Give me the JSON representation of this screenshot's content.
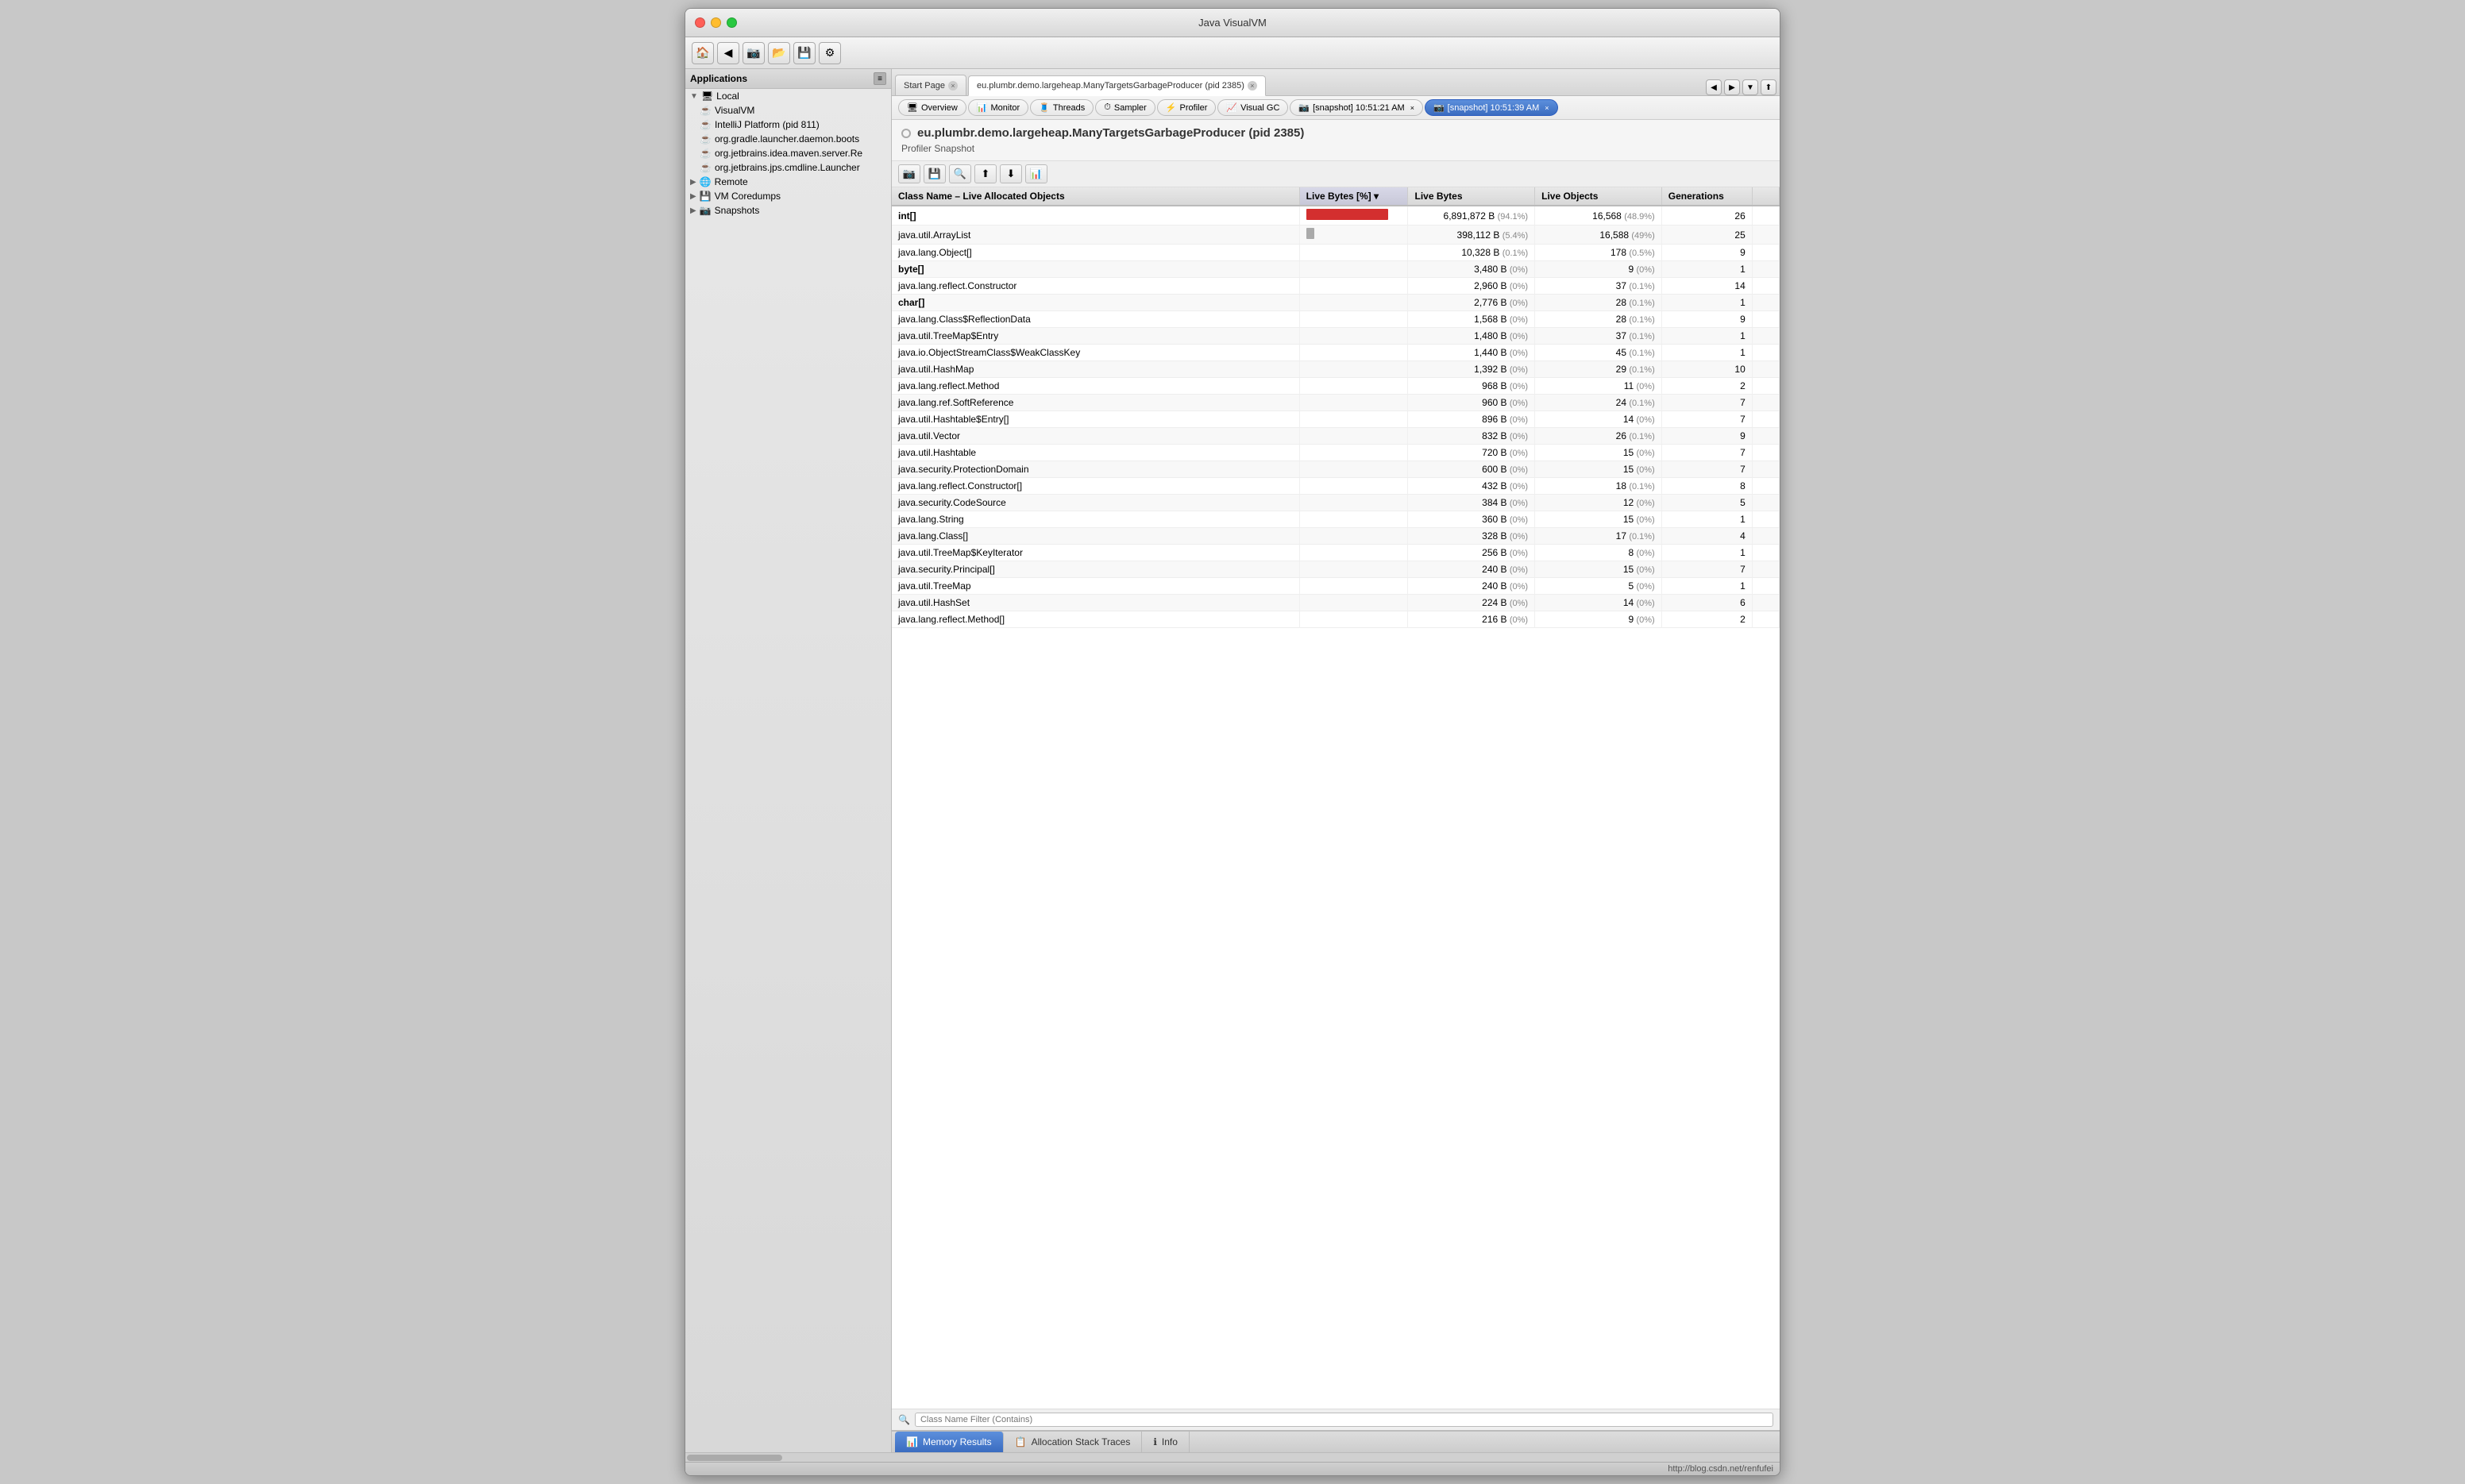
{
  "window": {
    "title": "Java VisualVM"
  },
  "toolbar": {
    "buttons": [
      "🏠",
      "⬅",
      "📷",
      "📁",
      "💾",
      "🔧"
    ]
  },
  "tabs": [
    {
      "label": "Start Page",
      "active": false,
      "closable": true
    },
    {
      "label": "eu.plumbr.demo.largeheap.ManyTargetsGarbageProducer (pid 2385)",
      "active": true,
      "closable": true
    }
  ],
  "nav_tabs": [
    {
      "label": "Overview",
      "icon": "🖥"
    },
    {
      "label": "Monitor",
      "icon": "📊"
    },
    {
      "label": "Threads",
      "icon": "🧵"
    },
    {
      "label": "Sampler",
      "icon": "⏱"
    },
    {
      "label": "Profiler",
      "icon": "⚡"
    },
    {
      "label": "Visual GC",
      "icon": "📈"
    },
    {
      "label": "[snapshot] 10:51:21 AM",
      "icon": "📷",
      "closable": true
    },
    {
      "label": "[snapshot] 10:51:39 AM",
      "icon": "📷",
      "active": true,
      "closable": true
    }
  ],
  "app": {
    "title": "eu.plumbr.demo.largeheap.ManyTargetsGarbageProducer (pid 2385)",
    "section": "Profiler Snapshot"
  },
  "sidebar": {
    "title": "Applications",
    "items": [
      {
        "label": "Local",
        "type": "group",
        "expanded": true,
        "indent": 0
      },
      {
        "label": "VisualVM",
        "type": "app",
        "indent": 1
      },
      {
        "label": "IntelliJ Platform (pid 811)",
        "type": "app",
        "indent": 1
      },
      {
        "label": "org.gradle.launcher.daemon.boots",
        "type": "app",
        "indent": 1
      },
      {
        "label": "org.jetbrains.idea.maven.server.Re",
        "type": "app",
        "indent": 1
      },
      {
        "label": "org.jetbrains.jps.cmdline.Launcher",
        "type": "app",
        "indent": 1
      },
      {
        "label": "Remote",
        "type": "group",
        "indent": 0
      },
      {
        "label": "VM Coredumps",
        "type": "group",
        "indent": 0
      },
      {
        "label": "Snapshots",
        "type": "group",
        "indent": 0
      }
    ]
  },
  "profiler_toolbar": {
    "buttons": [
      "📸",
      "💾",
      "🔍",
      "⬆",
      "⬇",
      "📊"
    ]
  },
  "table": {
    "columns": [
      {
        "label": "Class Name – Live Allocated Objects",
        "key": "class_name"
      },
      {
        "label": "Live Bytes [%]",
        "key": "bar",
        "sorted": true
      },
      {
        "label": "Live Bytes",
        "key": "live_bytes"
      },
      {
        "label": "Live Objects",
        "key": "live_objects"
      },
      {
        "label": "Generations",
        "key": "generations"
      }
    ],
    "rows": [
      {
        "class_name": "int[]",
        "bar": 94,
        "live_bytes": "6,891,872 B",
        "live_bytes_pct": "(94.1%)",
        "live_objects": "16,568",
        "live_objects_pct": "(48.9%)",
        "generations": "26",
        "bold": true
      },
      {
        "class_name": "java.util.ArrayList",
        "bar": 5,
        "live_bytes": "398,112 B",
        "live_bytes_pct": "(5.4%)",
        "live_objects": "16,588",
        "live_objects_pct": "(49%)",
        "generations": "25",
        "bold": false
      },
      {
        "class_name": "java.lang.Object[]",
        "bar": 0,
        "live_bytes": "10,328 B",
        "live_bytes_pct": "(0.1%)",
        "live_objects": "178",
        "live_objects_pct": "(0.5%)",
        "generations": "9",
        "bold": false
      },
      {
        "class_name": "byte[]",
        "bar": 0,
        "live_bytes": "3,480 B",
        "live_bytes_pct": "(0%)",
        "live_objects": "9",
        "live_objects_pct": "(0%)",
        "generations": "1",
        "bold": true
      },
      {
        "class_name": "java.lang.reflect.Constructor",
        "bar": 0,
        "live_bytes": "2,960 B",
        "live_bytes_pct": "(0%)",
        "live_objects": "37",
        "live_objects_pct": "(0.1%)",
        "generations": "14",
        "bold": false
      },
      {
        "class_name": "char[]",
        "bar": 0,
        "live_bytes": "2,776 B",
        "live_bytes_pct": "(0%)",
        "live_objects": "28",
        "live_objects_pct": "(0.1%)",
        "generations": "1",
        "bold": true
      },
      {
        "class_name": "java.lang.Class$ReflectionData",
        "bar": 0,
        "live_bytes": "1,568 B",
        "live_bytes_pct": "(0%)",
        "live_objects": "28",
        "live_objects_pct": "(0.1%)",
        "generations": "9",
        "bold": false
      },
      {
        "class_name": "java.util.TreeMap$Entry",
        "bar": 0,
        "live_bytes": "1,480 B",
        "live_bytes_pct": "(0%)",
        "live_objects": "37",
        "live_objects_pct": "(0.1%)",
        "generations": "1",
        "bold": false
      },
      {
        "class_name": "java.io.ObjectStreamClass$WeakClassKey",
        "bar": 0,
        "live_bytes": "1,440 B",
        "live_bytes_pct": "(0%)",
        "live_objects": "45",
        "live_objects_pct": "(0.1%)",
        "generations": "1",
        "bold": false
      },
      {
        "class_name": "java.util.HashMap",
        "bar": 0,
        "live_bytes": "1,392 B",
        "live_bytes_pct": "(0%)",
        "live_objects": "29",
        "live_objects_pct": "(0.1%)",
        "generations": "10",
        "bold": false
      },
      {
        "class_name": "java.lang.reflect.Method",
        "bar": 0,
        "live_bytes": "968 B",
        "live_bytes_pct": "(0%)",
        "live_objects": "11",
        "live_objects_pct": "(0%)",
        "generations": "2",
        "bold": false
      },
      {
        "class_name": "java.lang.ref.SoftReference",
        "bar": 0,
        "live_bytes": "960 B",
        "live_bytes_pct": "(0%)",
        "live_objects": "24",
        "live_objects_pct": "(0.1%)",
        "generations": "7",
        "bold": false
      },
      {
        "class_name": "java.util.Hashtable$Entry[]",
        "bar": 0,
        "live_bytes": "896 B",
        "live_bytes_pct": "(0%)",
        "live_objects": "14",
        "live_objects_pct": "(0%)",
        "generations": "7",
        "bold": false
      },
      {
        "class_name": "java.util.Vector",
        "bar": 0,
        "live_bytes": "832 B",
        "live_bytes_pct": "(0%)",
        "live_objects": "26",
        "live_objects_pct": "(0.1%)",
        "generations": "9",
        "bold": false
      },
      {
        "class_name": "java.util.Hashtable",
        "bar": 0,
        "live_bytes": "720 B",
        "live_bytes_pct": "(0%)",
        "live_objects": "15",
        "live_objects_pct": "(0%)",
        "generations": "7",
        "bold": false
      },
      {
        "class_name": "java.security.ProtectionDomain",
        "bar": 0,
        "live_bytes": "600 B",
        "live_bytes_pct": "(0%)",
        "live_objects": "15",
        "live_objects_pct": "(0%)",
        "generations": "7",
        "bold": false
      },
      {
        "class_name": "java.lang.reflect.Constructor[]",
        "bar": 0,
        "live_bytes": "432 B",
        "live_bytes_pct": "(0%)",
        "live_objects": "18",
        "live_objects_pct": "(0.1%)",
        "generations": "8",
        "bold": false
      },
      {
        "class_name": "java.security.CodeSource",
        "bar": 0,
        "live_bytes": "384 B",
        "live_bytes_pct": "(0%)",
        "live_objects": "12",
        "live_objects_pct": "(0%)",
        "generations": "5",
        "bold": false
      },
      {
        "class_name": "java.lang.String",
        "bar": 0,
        "live_bytes": "360 B",
        "live_bytes_pct": "(0%)",
        "live_objects": "15",
        "live_objects_pct": "(0%)",
        "generations": "1",
        "bold": false
      },
      {
        "class_name": "java.lang.Class[]",
        "bar": 0,
        "live_bytes": "328 B",
        "live_bytes_pct": "(0%)",
        "live_objects": "17",
        "live_objects_pct": "(0.1%)",
        "generations": "4",
        "bold": false
      },
      {
        "class_name": "java.util.TreeMap$KeyIterator",
        "bar": 0,
        "live_bytes": "256 B",
        "live_bytes_pct": "(0%)",
        "live_objects": "8",
        "live_objects_pct": "(0%)",
        "generations": "1",
        "bold": false
      },
      {
        "class_name": "java.security.Principal[]",
        "bar": 0,
        "live_bytes": "240 B",
        "live_bytes_pct": "(0%)",
        "live_objects": "15",
        "live_objects_pct": "(0%)",
        "generations": "7",
        "bold": false
      },
      {
        "class_name": "java.util.TreeMap",
        "bar": 0,
        "live_bytes": "240 B",
        "live_bytes_pct": "(0%)",
        "live_objects": "5",
        "live_objects_pct": "(0%)",
        "generations": "1",
        "bold": false
      },
      {
        "class_name": "java.util.HashSet",
        "bar": 0,
        "live_bytes": "224 B",
        "live_bytes_pct": "(0%)",
        "live_objects": "14",
        "live_objects_pct": "(0%)",
        "generations": "6",
        "bold": false
      },
      {
        "class_name": "java.lang.reflect.Method[]",
        "bar": 0,
        "live_bytes": "216 B",
        "live_bytes_pct": "(0%)",
        "live_objects": "9",
        "live_objects_pct": "(0%)",
        "generations": "2",
        "bold": false
      }
    ]
  },
  "filter": {
    "placeholder": "Class Name Filter (Contains)"
  },
  "bottom_tabs": [
    {
      "label": "Memory Results",
      "icon": "📊",
      "active": true
    },
    {
      "label": "Allocation Stack Traces",
      "icon": "📋",
      "active": false
    },
    {
      "label": "Info",
      "icon": "ℹ",
      "active": false
    }
  ],
  "status_bar": {
    "text": "http://blog.csdn.net/renfufei"
  }
}
